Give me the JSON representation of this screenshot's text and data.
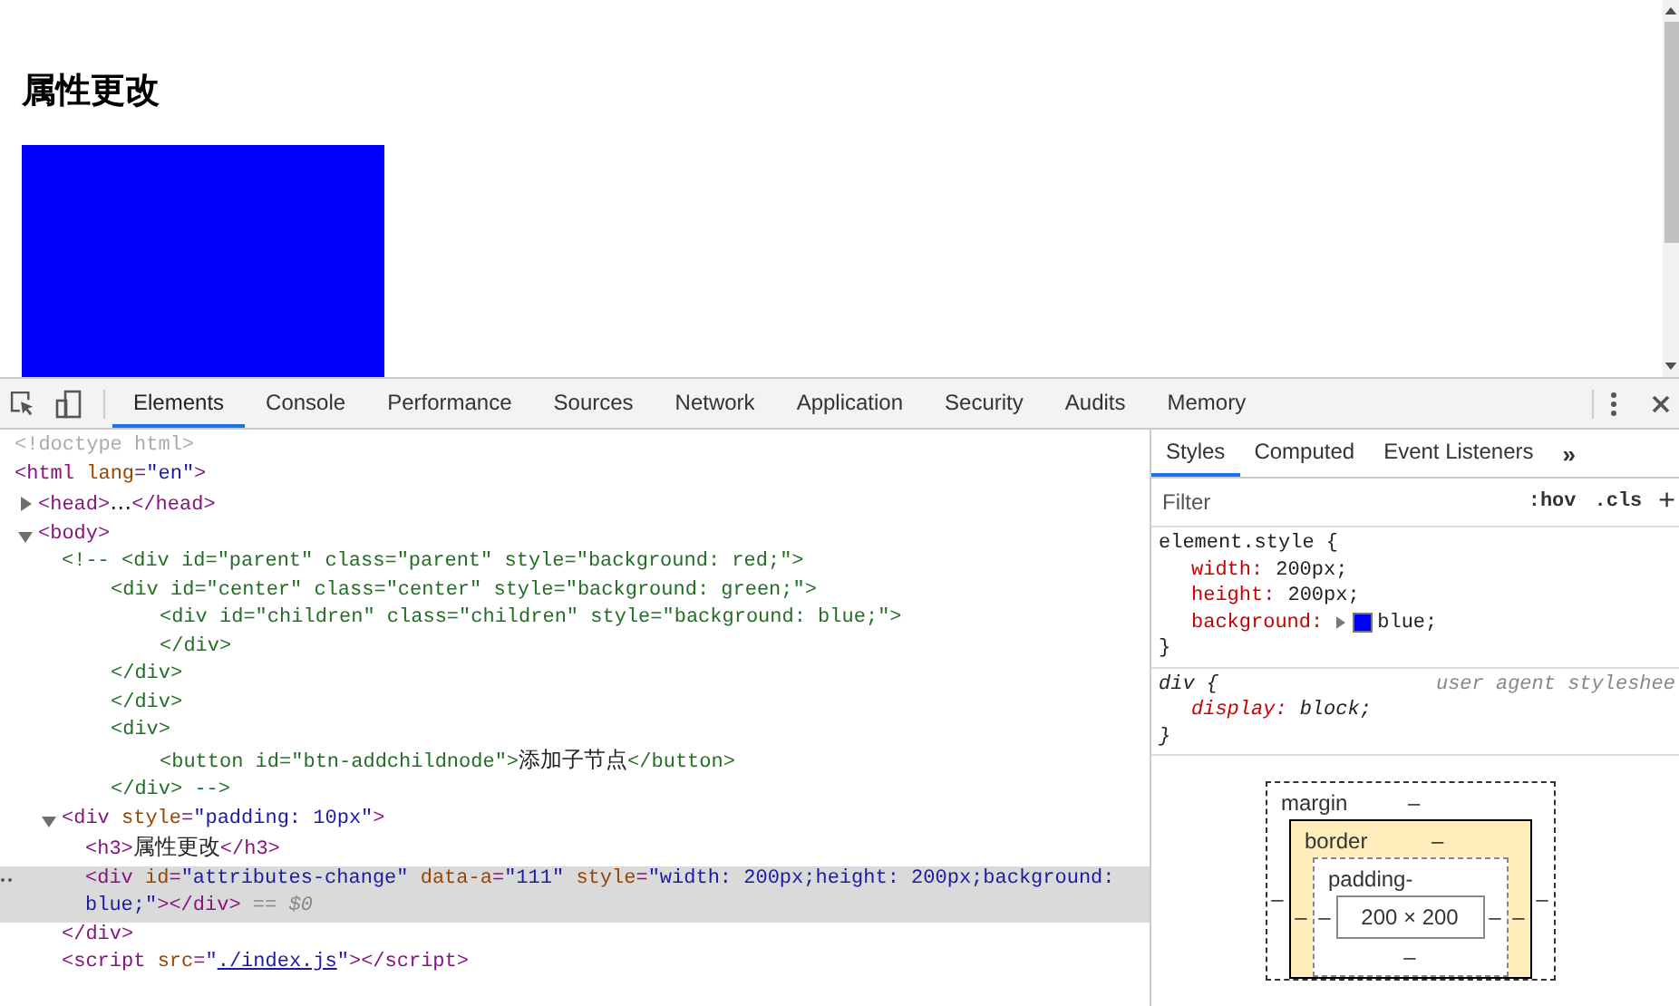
{
  "page": {
    "heading": "属性更改"
  },
  "toolbar": {
    "tabs": [
      {
        "label": "Elements",
        "selected": true
      },
      {
        "label": "Console",
        "selected": false
      },
      {
        "label": "Performance",
        "selected": false
      },
      {
        "label": "Sources",
        "selected": false
      },
      {
        "label": "Network",
        "selected": false
      },
      {
        "label": "Application",
        "selected": false
      },
      {
        "label": "Security",
        "selected": false
      },
      {
        "label": "Audits",
        "selected": false
      },
      {
        "label": "Memory",
        "selected": false
      }
    ]
  },
  "dom": [
    {
      "selected": false,
      "tokens": [
        {
          "kind": "doctype",
          "text": "<!doctype html>"
        }
      ]
    },
    {
      "selected": false,
      "tokens": [
        {
          "kind": "tag",
          "text": "<html"
        },
        {
          "kind": "attr",
          "text": " lang"
        },
        {
          "kind": "tag",
          "text": "="
        },
        {
          "kind": "value",
          "text": "\"en\""
        },
        {
          "kind": "tag",
          "text": ">"
        }
      ],
      "children": [
        {
          "selected": false,
          "expanded": false,
          "tokens": [
            {
              "kind": "tag",
              "text": "<head>"
            },
            {
              "kind": "text",
              "text": "…"
            },
            {
              "kind": "tag",
              "text": "</head>"
            }
          ]
        },
        {
          "selected": false,
          "expanded": true,
          "tokens": [
            {
              "kind": "tag",
              "text": "<body>"
            }
          ],
          "children": [
            {
              "selected": false,
              "kind": "comment",
              "tokens": [
                {
                  "kind": "comment",
                  "text": "<!-- <div id=\"parent\" class=\"parent\" style=\"background: red;\">"
                }
              ],
              "children": [
                {
                  "selected": false,
                  "tokens": [
                    {
                      "kind": "comment",
                      "text": "<div id=\"center\" class=\"center\" style=\"background: green;\">"
                    }
                  ],
                  "children": [
                    {
                      "selected": false,
                      "tokens": [
                        {
                          "kind": "comment",
                          "text": "<div id=\"children\" class=\"children\" style=\"background: blue;\">"
                        }
                      ]
                    },
                    {
                      "selected": false,
                      "tokens": [
                        {
                          "kind": "comment",
                          "text": "</div>"
                        }
                      ]
                    }
                  ]
                },
                {
                  "selected": false,
                  "tokens": [
                    {
                      "kind": "comment",
                      "text": "</div>"
                    }
                  ]
                },
                {
                  "selected": false,
                  "tokens": [
                    {
                      "kind": "comment",
                      "text": "</div>"
                    }
                  ]
                },
                {
                  "selected": false,
                  "tokens": [
                    {
                      "kind": "comment",
                      "text": "<div>"
                    }
                  ],
                  "children": [
                    {
                      "selected": false,
                      "tokens": [
                        {
                          "kind": "comment",
                          "text": "<button id=\"btn-addchildnode\">"
                        },
                        {
                          "kind": "text",
                          "text": "添加子节点"
                        },
                        {
                          "kind": "comment",
                          "text": "</button>"
                        }
                      ]
                    }
                  ]
                },
                {
                  "selected": false,
                  "tokens": [
                    {
                      "kind": "comment",
                      "text": "</div> -->"
                    }
                  ]
                }
              ]
            },
            {
              "selected": false,
              "expanded": true,
              "tokens": [
                {
                  "kind": "tag",
                  "text": "<div"
                },
                {
                  "kind": "attr",
                  "text": " style"
                },
                {
                  "kind": "tag",
                  "text": "="
                },
                {
                  "kind": "value",
                  "text": "\"padding: 10px\""
                },
                {
                  "kind": "tag",
                  "text": ">"
                }
              ],
              "children": [
                {
                  "selected": false,
                  "tokens": [
                    {
                      "kind": "tag",
                      "text": "<h3>"
                    },
                    {
                      "kind": "text",
                      "text": "属性更改"
                    },
                    {
                      "kind": "tag",
                      "text": "</h3>"
                    }
                  ]
                },
                {
                  "selected": true,
                  "tokens": [
                    {
                      "kind": "tag",
                      "text": "<div"
                    },
                    {
                      "kind": "attr",
                      "text": " id"
                    },
                    {
                      "kind": "tag",
                      "text": "="
                    },
                    {
                      "kind": "value",
                      "text": "\"attributes-change\""
                    },
                    {
                      "kind": "attr",
                      "text": " data-a"
                    },
                    {
                      "kind": "tag",
                      "text": "="
                    },
                    {
                      "kind": "value",
                      "text": "\"111\""
                    },
                    {
                      "kind": "attr",
                      "text": " style"
                    },
                    {
                      "kind": "tag",
                      "text": "="
                    },
                    {
                      "kind": "value",
                      "text": "\"width: 200px;height: 200px;background: blue;\""
                    },
                    {
                      "kind": "tag",
                      "text": "></div>"
                    },
                    {
                      "kind": "marker",
                      "text": " == $0"
                    }
                  ]
                }
              ]
            },
            {
              "selected": false,
              "tokens": [
                {
                  "kind": "tag",
                  "text": "</div>"
                }
              ]
            },
            {
              "selected": false,
              "tokens": [
                {
                  "kind": "tag",
                  "text": "<script"
                },
                {
                  "kind": "attr",
                  "text": " src"
                },
                {
                  "kind": "tag",
                  "text": "="
                },
                {
                  "kind": "value",
                  "text": "\""
                },
                {
                  "kind": "link",
                  "text": "./index.js"
                },
                {
                  "kind": "value",
                  "text": "\""
                },
                {
                  "kind": "tag",
                  "text": "></script>"
                }
              ]
            }
          ]
        }
      ]
    }
  ],
  "styles": {
    "tabs": [
      {
        "label": "Styles",
        "selected": true
      },
      {
        "label": "Computed",
        "selected": false
      },
      {
        "label": "Event Listeners",
        "selected": false
      }
    ],
    "more": "»",
    "filter": {
      "placeholder": "Filter"
    },
    "hov": ":hov",
    "cls": ".cls",
    "add": "+",
    "rules": [
      {
        "kind": "inline",
        "selector": "element.style {",
        "declarations": [
          {
            "property": "width:",
            "value": "200px;"
          },
          {
            "property": "height:",
            "value": "200px;"
          },
          {
            "property": "background:",
            "expandable": true,
            "color": "#0000ff",
            "value": "blue;"
          }
        ],
        "close": "}"
      },
      {
        "kind": "user-agent",
        "selector": "div {",
        "origin": "user agent styleshee",
        "declarations": [
          {
            "property": "display:",
            "value": "block;"
          }
        ],
        "close": "}"
      }
    ],
    "box_model": {
      "margin": {
        "label": "margin",
        "top": "–",
        "left": "–",
        "right": "–"
      },
      "border": {
        "label": "border",
        "top": "–",
        "left": "–",
        "right": "–"
      },
      "padding": {
        "label": "padding",
        "top": "-",
        "left": "–",
        "right": "–",
        "bottom": "–"
      },
      "content": "200 × 200"
    }
  }
}
